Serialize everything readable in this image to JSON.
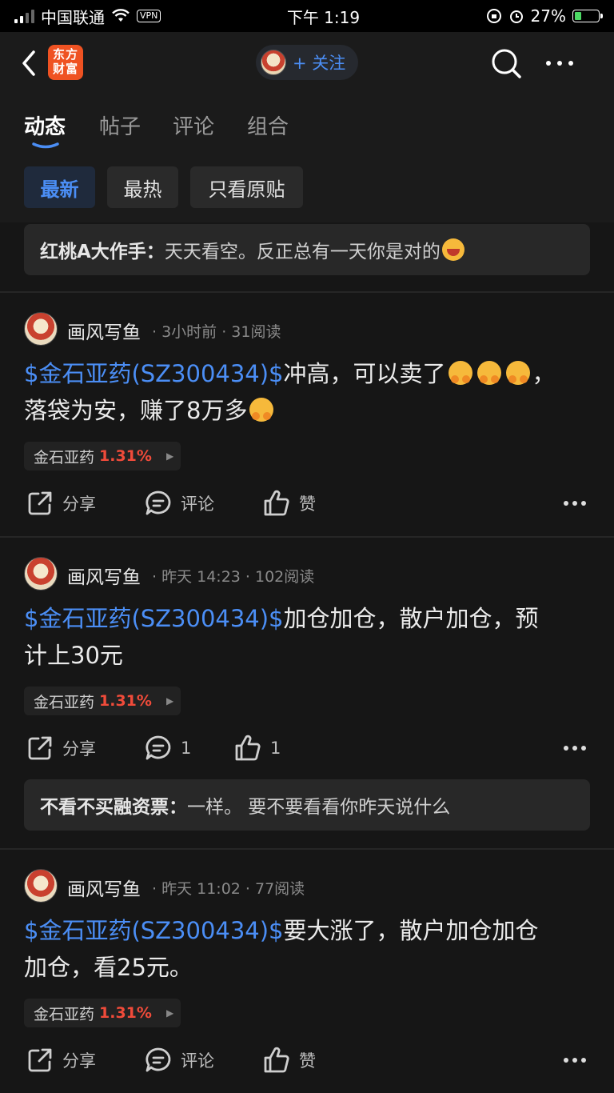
{
  "status_bar": {
    "carrier": "中国联通",
    "vpn": "VPN",
    "time": "下午 1:19",
    "battery": "27%"
  },
  "nav": {
    "logo_line1": "东方",
    "logo_line2": "财富",
    "follow_label": "+ 关注"
  },
  "tabs": [
    "动态",
    "帖子",
    "评论",
    "组合"
  ],
  "filters": [
    "最新",
    "最热",
    "只看原贴"
  ],
  "top_quote": {
    "author": "红桃A大作手：",
    "text": "天天看空。反正总有一天你是对的"
  },
  "posts": [
    {
      "author": "画风写鱼",
      "meta": "· 3小时前 · 31阅读",
      "stock_link": "$金石亚药(SZ300434)$",
      "text_line1": "冲高，可以卖了",
      "text_line2": "，",
      "text_line3": "落袋为安，赚了8万多",
      "tag_name": "金石亚药",
      "tag_pct": "1.31%",
      "share_label": "分享",
      "comment_label": "评论",
      "like_label": "赞"
    },
    {
      "author": "画风写鱼",
      "meta": "· 昨天 14:23 · 102阅读",
      "stock_link": "$金石亚药(SZ300434)$",
      "text_line1": "加仓加仓，散户加仓，预",
      "text_line3": "计上30元",
      "tag_name": "金石亚药",
      "tag_pct": "1.31%",
      "share_label": "分享",
      "comment_label": "1",
      "like_label": "1",
      "quote_author": "不看不买融资票：",
      "quote_text": "一样。 要不要看看你昨天说什么"
    },
    {
      "author": "画风写鱼",
      "meta": "· 昨天 11:02 · 77阅读",
      "stock_link": "$金石亚药(SZ300434)$",
      "text_line1": "要大涨了，散户加仓加仓",
      "text_line3": "加仓，看25元。",
      "tag_name": "金石亚药",
      "tag_pct": "1.31%",
      "share_label": "分享",
      "comment_label": "评论",
      "like_label": "赞"
    }
  ],
  "colors": {
    "accent_blue": "#4b8ef5",
    "rise_red": "#f04b3a",
    "brand_orange": "#ef5222"
  }
}
